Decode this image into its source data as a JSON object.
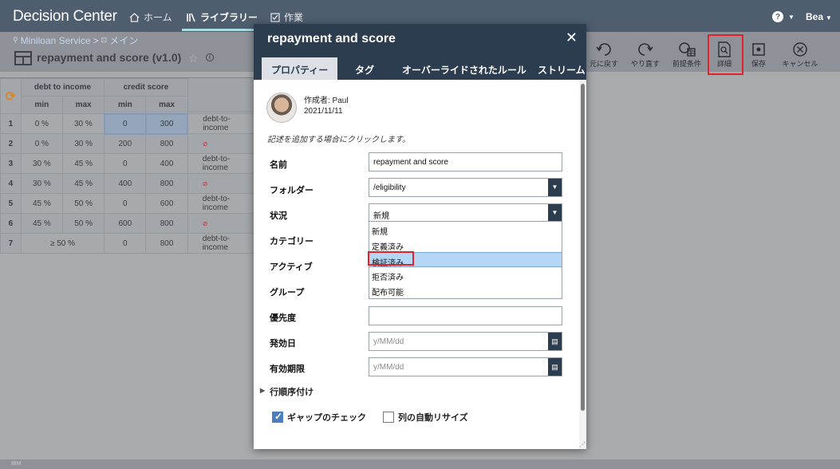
{
  "app": {
    "title": "Decision Center",
    "nav": [
      {
        "label": "ホーム",
        "icon": "home-icon"
      },
      {
        "label": "ライブラリー",
        "icon": "library-icon"
      },
      {
        "label": "作業",
        "icon": "task-icon"
      }
    ],
    "help_label": "?",
    "user_name": "Bea"
  },
  "subheader": {
    "breadcrumb": [
      "Miniloan Service",
      ">",
      "メイン"
    ],
    "page_title": "repayment and score (v1.0)"
  },
  "toolbar": [
    {
      "label": "元に戻す",
      "icon": "undo-icon"
    },
    {
      "label": "やり直す",
      "icon": "redo-icon"
    },
    {
      "label": "前提条件",
      "icon": "preconditions-icon"
    },
    {
      "label": "詳細",
      "icon": "details-icon"
    },
    {
      "label": "保存",
      "icon": "save-icon"
    },
    {
      "label": "キャンセル",
      "icon": "cancel-icon"
    }
  ],
  "grid": {
    "groups": [
      "debt to income",
      "credit score"
    ],
    "subheaders": [
      "min",
      "max",
      "min",
      "max"
    ],
    "rows": [
      {
        "num": "1",
        "dmin": "0 %",
        "dmax": "30 %",
        "cmin": "0",
        "cmax": "300",
        "action": "debt-to-income"
      },
      {
        "num": "2",
        "dmin": "0 %",
        "dmax": "30 %",
        "cmin": "200",
        "cmax": "800",
        "action": ""
      },
      {
        "num": "3",
        "dmin": "30 %",
        "dmax": "45 %",
        "cmin": "0",
        "cmax": "400",
        "action": "debt-to-income"
      },
      {
        "num": "4",
        "dmin": "30 %",
        "dmax": "45 %",
        "cmin": "400",
        "cmax": "800",
        "action": ""
      },
      {
        "num": "5",
        "dmin": "45 %",
        "dmax": "50 %",
        "cmin": "0",
        "cmax": "600",
        "action": "debt-to-income"
      },
      {
        "num": "6",
        "dmin": "45 %",
        "dmax": "50 %",
        "cmin": "600",
        "cmax": "800",
        "action": ""
      },
      {
        "num": "7",
        "dmerged": "≥ 50 %",
        "cmin": "0",
        "cmax": "800",
        "action": "debt-to-income"
      }
    ]
  },
  "modal": {
    "title": "repayment and score",
    "close": "✕",
    "tabs": [
      "プロパティー",
      "タグ",
      "オーバーライドされたルール",
      "ストリーム"
    ],
    "author_line": "作成者: Paul",
    "date_line": "2021/11/11",
    "description_hint": "記述を追加する場合にクリックします。",
    "props": {
      "name_label": "名前",
      "name_value": "repayment and score",
      "folder_label": "フォルダー",
      "folder_value": "/eligibility",
      "status_label": "状況",
      "status_value": "新規",
      "category_label": "カテゴリー",
      "active_label": "アクティブ",
      "group_label": "グループ",
      "priority_label": "優先度",
      "priority_value": "",
      "effective_label": "発効日",
      "effective_placeholder": "y/MM/dd",
      "expiration_label": "有効期限",
      "expiration_placeholder": "y/MM/dd"
    },
    "status_options": [
      "新規",
      "定義済み",
      "検証済み",
      "拒否済み",
      "配布可能"
    ],
    "row_order_label": "行順序付け",
    "gap_check_label": "ギャップのチェック",
    "gap_check_checked": true,
    "auto_resize_label": "列の自動リサイズ",
    "auto_resize_checked": false
  },
  "footer": {
    "brand": "IBM"
  }
}
